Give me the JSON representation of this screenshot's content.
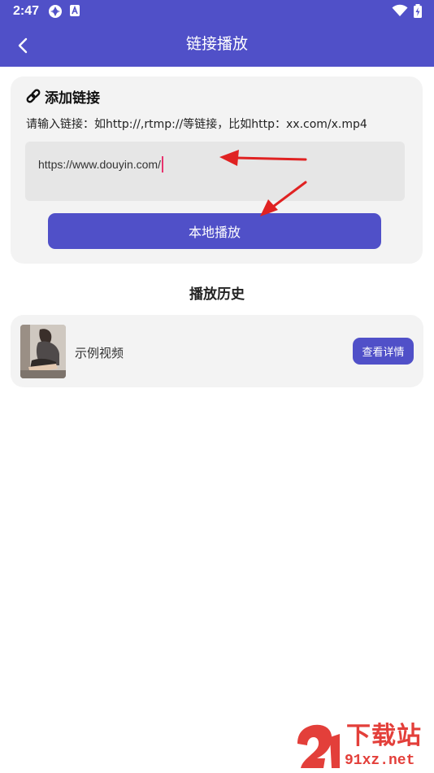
{
  "status_bar": {
    "time": "2:47"
  },
  "header": {
    "title": "链接播放"
  },
  "add_link": {
    "heading": "添加链接",
    "hint": "请输入链接：如http://,rtmp://等链接，比如http：xx.com/x.mp4",
    "url_value": "https://www.douyin.com/",
    "play_button": "本地播放"
  },
  "history": {
    "title": "播放历史",
    "items": [
      {
        "title": "示例视频",
        "button": "查看详情"
      }
    ]
  },
  "watermark": {
    "main": "下载站",
    "sub": "91xz.net"
  },
  "colors": {
    "primary": "#5050c8",
    "card_bg": "#f3f3f3",
    "input_bg": "#e6e6e6",
    "arrow": "#e02222",
    "caret": "#e8336e",
    "watermark": "#e33f3a"
  },
  "icons": [
    "back-arrow-icon",
    "link-icon",
    "status-app-icon",
    "status-a-icon",
    "wifi-icon",
    "battery-icon"
  ]
}
